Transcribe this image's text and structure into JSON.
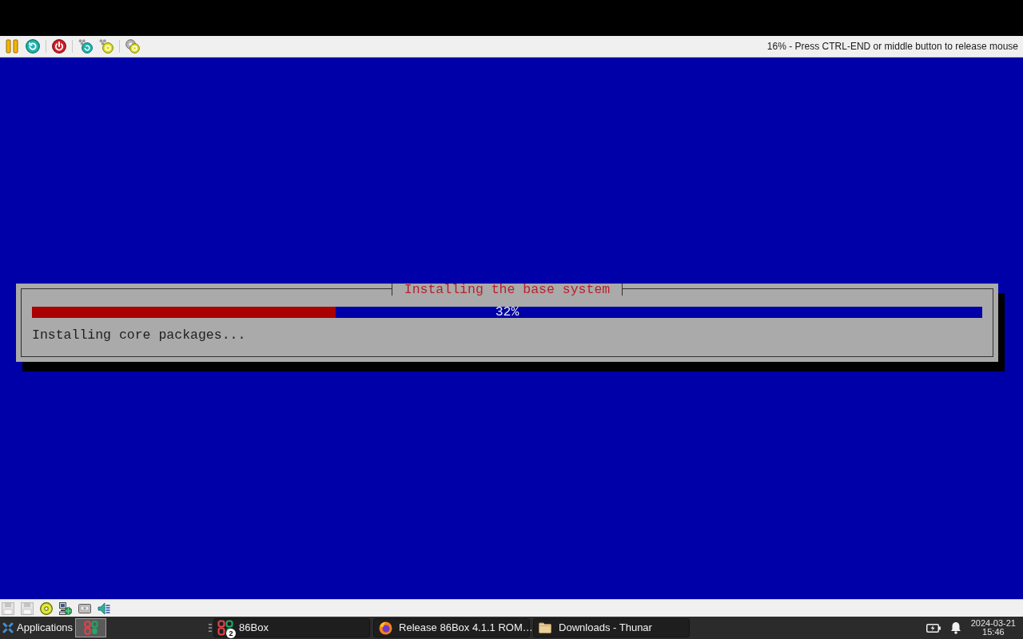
{
  "emulator_toolbar": {
    "status_text": "16% - Press CTRL-END or middle button to release mouse"
  },
  "installer_dialog": {
    "title": "Installing the base system",
    "progress": {
      "level": 0.32,
      "text": "32%"
    },
    "message": "Installing core packages..."
  },
  "taskbar": {
    "menu_label": "Applications",
    "tasks": [
      {
        "kind": "emulator",
        "label": "86Box",
        "badge": "2"
      },
      {
        "kind": "browser",
        "label": "Release 86Box 4.1.1 ROM…"
      },
      {
        "kind": "folder",
        "label": "Downloads - Thunar"
      }
    ],
    "clock": {
      "date": "2024-03-21",
      "time": "15:46"
    }
  }
}
